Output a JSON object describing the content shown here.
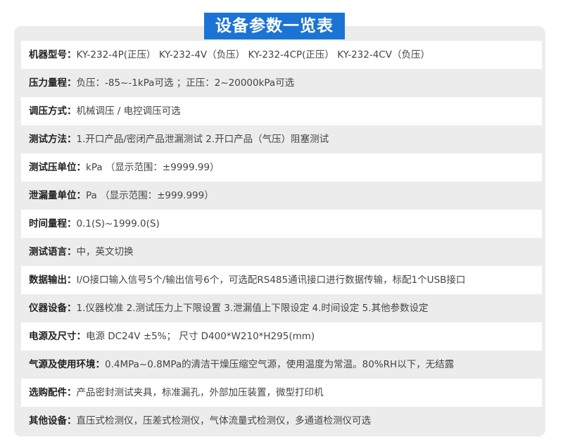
{
  "title": "设备参数一览表",
  "rows": [
    {
      "label": "机器型号：",
      "value": "KY-232-4P(正压）  KY-232-4V（负压）   KY-232-4CP(正压）  KY-232-4CV（负压）"
    },
    {
      "label": "压力量程：",
      "value": "负压：-85~-1kPa可选 ；正压：2~20000kPa可选"
    },
    {
      "label": "调压方式：",
      "value": "机械调压 / 电控调压可选"
    },
    {
      "label": "测试方法：",
      "value": "1.开口产品/密闭产品泄漏测试   2.开口产品（气压）阻塞测试"
    },
    {
      "label": "测试压单位：",
      "value": "kPa   （显示范围：±9999.99）"
    },
    {
      "label": "泄漏量单位：",
      "value": "Pa    （显示范围：±999.999）"
    },
    {
      "label": "时间量程：",
      "value": "0.1(S)~1999.0(S)"
    },
    {
      "label": "测试语言：",
      "value": "中，英文切换"
    },
    {
      "label": "数据输出：",
      "value": "I/O接口输入信号5个/输出信号6个，可选配RS485通讯接口进行数据传输，标配1个USB接口"
    },
    {
      "label": "仪器设备：",
      "value": "1.仪器校准  2.测试压力上下限设置  3.泄漏值上下限设定  4.时间设定   5.其他参数设定"
    },
    {
      "label": "电源及尺寸：",
      "value": "电源 DC24V  ±5%；  尺寸 D400*W210*H295(mm)"
    },
    {
      "label": "气源及使用环境：",
      "value": "0.4MPa~0.8MPa的清洁干燥压缩空气源，使用温度为常温。80%RH以下，无结露"
    },
    {
      "label": "选购配件：",
      "value": "产品密封测试夹具，标准漏孔，外部加压装置，微型打印机"
    },
    {
      "label": "其他设备：",
      "value": "直压式检测仪，压差式检测仪，气体流量式检测仪，多通道检测仪可选"
    }
  ]
}
